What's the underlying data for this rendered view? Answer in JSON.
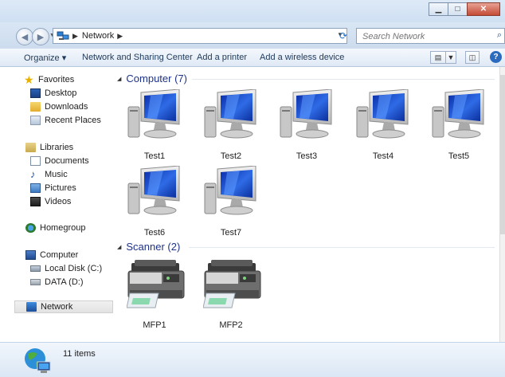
{
  "window": {
    "minimize_icon": "minimize-icon",
    "maximize_icon": "maximize-icon",
    "close_icon": "close-icon"
  },
  "address": {
    "path": [
      "Network"
    ],
    "search_placeholder": "Search Network"
  },
  "toolbar": {
    "organize": "Organize",
    "network_sharing": "Network and Sharing Center",
    "add_printer": "Add a printer",
    "add_wireless": "Add a wireless device"
  },
  "sidebar": {
    "favorites": {
      "label": "Favorites",
      "items": [
        "Desktop",
        "Downloads",
        "Recent Places"
      ]
    },
    "libraries": {
      "label": "Libraries",
      "items": [
        "Documents",
        "Music",
        "Pictures",
        "Videos"
      ]
    },
    "homegroup": "Homegroup",
    "computer": {
      "label": "Computer",
      "items": [
        "Local Disk (C:)",
        "DATA (D:)"
      ]
    },
    "network": "Network"
  },
  "groups": {
    "computer": {
      "title": "Computer (7)",
      "items": [
        "Test1",
        "Test2",
        "Test3",
        "Test4",
        "Test5",
        "Test6",
        "Test7"
      ]
    },
    "scanner": {
      "title": "Scanner (2)",
      "items": [
        "MFP1",
        "MFP2"
      ]
    }
  },
  "status": {
    "text": "11 items"
  },
  "colors": {
    "header_text": "#1e3287",
    "accent": "#2a6bc0",
    "selection": "#e2e2e2"
  }
}
